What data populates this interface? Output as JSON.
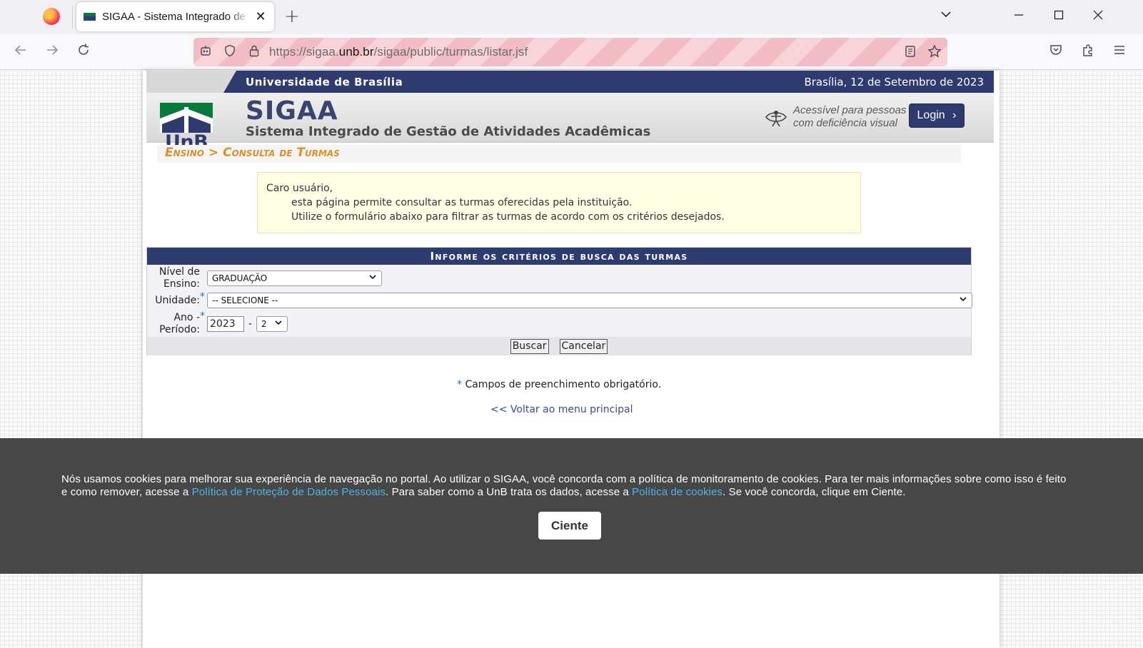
{
  "browser": {
    "tab_title": "SIGAA - Sistema Integrado de Gestão de Atividades Acadêmicas",
    "tab_close": "✕",
    "new_tab": "+",
    "url_prefix": "https://sigaa.",
    "url_domain": "unb.br",
    "url_path": "/sigaa/public/turmas/listar.jsf"
  },
  "header": {
    "university": "Universidade de Brasília",
    "date": "Brasília, 12 de Setembro de 2023",
    "logo_text": "UnB",
    "system_name": "SIGAA",
    "system_full_name": "Sistema Integrado de Gestão de Atividades Acadêmicas",
    "accessibility_line1": "Acessível para pessoas",
    "accessibility_line2": "com deficiência visual",
    "login_label": "Login",
    "login_chevron": "›"
  },
  "breadcrumb": {
    "text": "Ensino > Consulta de Turmas"
  },
  "notice": {
    "greeting": "Caro usuário,",
    "line1": "esta página permite consultar as turmas oferecidas pela instituição.",
    "line2": "Utilize o formulário abaixo para filtrar as turmas de acordo com os critérios desejados."
  },
  "form": {
    "caption": "Informe os critérios de busca das turmas",
    "nivel_label": "Nível de Ensino:",
    "nivel_value": "GRADUAÇÃO",
    "unidade_label": "Unidade:",
    "unidade_value": "-- SELECIONE --",
    "ano_label": "Ano - Período:",
    "ano_value": "2023",
    "separator": "-",
    "periodo_value": "2",
    "required_mark": "*",
    "buscar_label": "Buscar",
    "cancelar_label": "Cancelar"
  },
  "footer": {
    "required_note": "Campos de preenchimento obrigatório.",
    "back_link": "<< Voltar ao menu principal"
  },
  "cookie": {
    "text_part1": "Nós usamos cookies para melhorar sua experiência de navegação no portal. Ao utilizar o SIGAA, você concorda com a política de monitoramento de cookies. Para ter mais informações sobre como isso é feito e como remover, acesse a ",
    "link1": "Política de Proteção de Dados Pessoais",
    "text_part2": ". Para saber como a UnB trata os dados, acesse a ",
    "link2": "Política de cookies",
    "text_part3": ". Se você concorda, clique em Ciente.",
    "button_label": "Ciente"
  },
  "colors": {
    "primary": "#2e3b6e",
    "breadcrumb": "#d9902c",
    "notice_bg": "#ffffe5",
    "cookie_bg": "#474747",
    "cookie_link": "#4fb4e8"
  }
}
